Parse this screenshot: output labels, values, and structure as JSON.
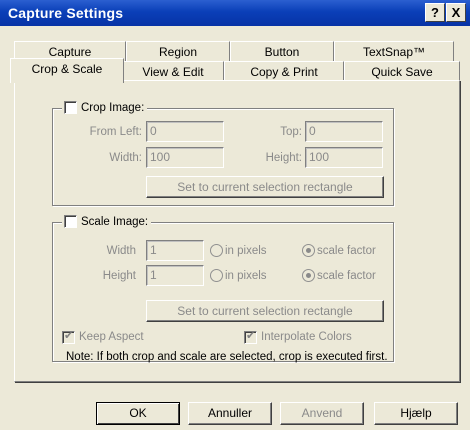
{
  "window": {
    "title": "Capture Settings",
    "help_button": "?",
    "close_button": "X"
  },
  "tabs": {
    "row_back": [
      "Capture",
      "Region",
      "Button",
      "TextSnap™"
    ],
    "row_front": [
      "Crop & Scale",
      "View & Edit",
      "Copy & Print",
      "Quick Save"
    ],
    "active": "Crop & Scale"
  },
  "crop": {
    "label": "Crop Image:",
    "checked": false,
    "from_left_label": "From Left:",
    "from_left_value": "0",
    "top_label": "Top:",
    "top_value": "0",
    "width_label": "Width:",
    "width_value": "100",
    "height_label": "Height:",
    "height_value": "100",
    "set_button": "Set to current selection rectangle"
  },
  "scale": {
    "label": "Scale Image:",
    "checked": false,
    "width_label": "Width",
    "width_value": "1",
    "height_label": "Height",
    "height_value": "1",
    "in_pixels_label": "in pixels",
    "scale_factor_label": "scale factor",
    "selected_mode": "scale factor",
    "set_button": "Set to current selection rectangle"
  },
  "options": {
    "keep_aspect": "Keep Aspect",
    "keep_aspect_checked": true,
    "interpolate_colors": "Interpolate Colors",
    "interpolate_colors_checked": true
  },
  "note": "Note: If both crop and scale are selected, crop is executed first.",
  "buttons": {
    "ok": "OK",
    "cancel": "Annuller",
    "apply": "Anvend",
    "help": "Hjælp"
  }
}
